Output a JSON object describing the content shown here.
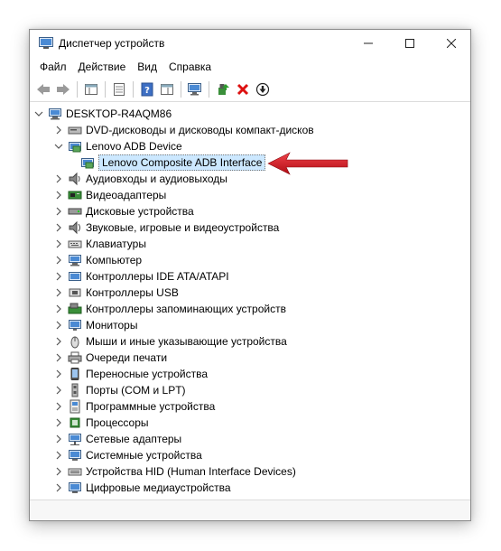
{
  "window": {
    "title": "Диспетчер устройств",
    "minimize_glyph": "—",
    "maximize_glyph": "☐",
    "close_glyph": "✕"
  },
  "menu": [
    "Файл",
    "Действие",
    "Вид",
    "Справка"
  ],
  "toolbar": [
    "back-icon",
    "forward-icon",
    "show-hidden-icon",
    "properties-icon",
    "help-icon",
    "console-tree-icon",
    "scan-hardware-icon",
    "update-driver-icon",
    "uninstall-icon",
    "disable-icon"
  ],
  "tree": {
    "root": "DESKTOP-R4AQM86",
    "items": [
      {
        "label": "DVD-дисководы и дисководы компакт-дисков",
        "icon": "dvd-icon",
        "expanded": false
      },
      {
        "label": "Lenovo ADB Device",
        "icon": "adb-device-icon",
        "expanded": true
      },
      {
        "label": "Lenovo Composite ADB Interface",
        "icon": "adb-interface-icon",
        "child": true,
        "selected": true
      },
      {
        "label": "Аудиовходы и аудиовыходы",
        "icon": "speaker-icon",
        "expanded": false
      },
      {
        "label": "Видеоадаптеры",
        "icon": "display-adapter-icon",
        "expanded": false
      },
      {
        "label": "Дисковые устройства",
        "icon": "disk-drive-icon",
        "expanded": false
      },
      {
        "label": "Звуковые, игровые и видеоустройства",
        "icon": "sound-icon",
        "expanded": false
      },
      {
        "label": "Клавиатуры",
        "icon": "keyboard-icon",
        "expanded": false
      },
      {
        "label": "Компьютер",
        "icon": "computer-icon",
        "expanded": false
      },
      {
        "label": "Контроллеры IDE ATA/ATAPI",
        "icon": "ide-controller-icon",
        "expanded": false
      },
      {
        "label": "Контроллеры USB",
        "icon": "usb-controller-icon",
        "expanded": false
      },
      {
        "label": "Контроллеры запоминающих устройств",
        "icon": "storage-controller-icon",
        "expanded": false
      },
      {
        "label": "Мониторы",
        "icon": "monitor-icon",
        "expanded": false
      },
      {
        "label": "Мыши и иные указывающие устройства",
        "icon": "mouse-icon",
        "expanded": false
      },
      {
        "label": "Очереди печати",
        "icon": "printer-icon",
        "expanded": false
      },
      {
        "label": "Переносные устройства",
        "icon": "portable-device-icon",
        "expanded": false
      },
      {
        "label": "Порты (COM и LPT)",
        "icon": "port-icon",
        "expanded": false
      },
      {
        "label": "Программные устройства",
        "icon": "software-device-icon",
        "expanded": false
      },
      {
        "label": "Процессоры",
        "icon": "processor-icon",
        "expanded": false
      },
      {
        "label": "Сетевые адаптеры",
        "icon": "network-adapter-icon",
        "expanded": false
      },
      {
        "label": "Системные устройства",
        "icon": "system-device-icon",
        "expanded": false
      },
      {
        "label": "Устройства HID (Human Interface Devices)",
        "icon": "hid-icon",
        "expanded": false
      },
      {
        "label": "Цифровые медиаустройства",
        "icon": "media-device-icon",
        "expanded": false
      }
    ]
  },
  "colors": {
    "selection": "#cce8ff",
    "arrow": "#d0121b"
  }
}
